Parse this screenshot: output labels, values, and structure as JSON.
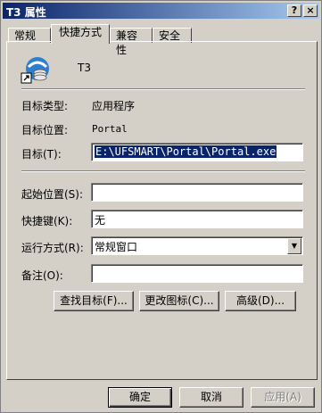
{
  "window": {
    "title": "T3 属性",
    "help_glyph": "?",
    "close_glyph": "×"
  },
  "tabs": [
    {
      "label": "常规"
    },
    {
      "label": "快捷方式"
    },
    {
      "label": "兼容性"
    },
    {
      "label": "安全"
    }
  ],
  "shortcut": {
    "name": "T3",
    "target_type_label": "目标类型:",
    "target_type_value": "应用程序",
    "target_location_label": "目标位置:",
    "target_location_value": "Portal",
    "target_label": "目标(T):",
    "target_value": "E:\\UFSMART\\Portal\\Portal.exe",
    "start_in_label": "起始位置(S):",
    "start_in_value": "",
    "hotkey_label": "快捷键(K):",
    "hotkey_value": "无",
    "run_label": "运行方式(R):",
    "run_value": "常规窗口",
    "comment_label": "备注(O):",
    "comment_value": "",
    "find_target_button": "查找目标(F)...",
    "change_icon_button": "更改图标(C)...",
    "advanced_button": "高级(D)..."
  },
  "footer": {
    "ok": "确定",
    "cancel": "取消",
    "apply": "应用(A)"
  },
  "colors": {
    "titlebar": "#0a246a",
    "face": "#d4d0c8",
    "selection": "#0a246a"
  }
}
